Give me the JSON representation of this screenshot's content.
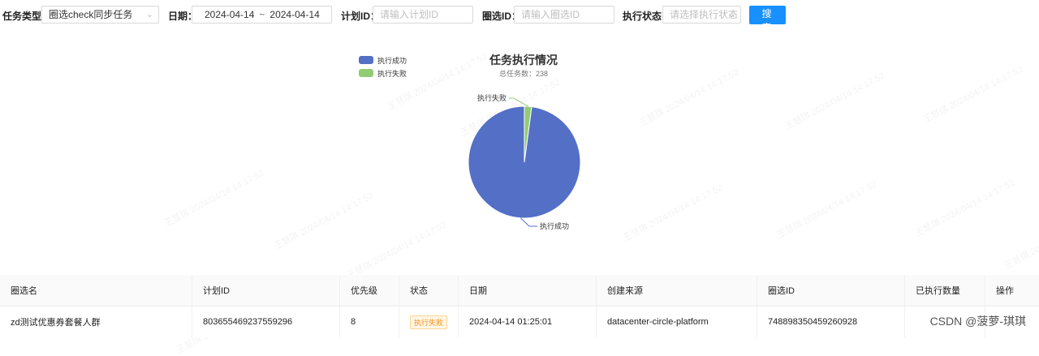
{
  "filters": {
    "task_type_label": "任务类型：",
    "task_type_value": "圈选check同步任务",
    "date_label": "日期：",
    "date_start": "2024-04-14",
    "date_sep": "~",
    "date_end": "2024-04-14",
    "plan_id_label": "计划ID：",
    "plan_id_placeholder": "请输入计划ID",
    "circle_id_label": "圈选ID：",
    "circle_id_placeholder": "请输入圈选ID",
    "status_label": "执行状态：",
    "status_placeholder": "请选择执行状态",
    "search_label": "搜 索"
  },
  "chart": {
    "title": "任务执行情况",
    "subtitle": "总任务数：238",
    "legend": [
      {
        "name": "执行成功",
        "color": "#5470c6"
      },
      {
        "name": "执行失败",
        "color": "#91cc75"
      }
    ],
    "success_label": "执行成功",
    "fail_label": "执行失败"
  },
  "chart_data": {
    "type": "pie",
    "title": "任务执行情况",
    "subtitle": "总任务数：238",
    "slices": [
      {
        "name": "执行成功",
        "value": 233,
        "color": "#5470c6"
      },
      {
        "name": "执行失败",
        "value": 5,
        "color": "#91cc75"
      }
    ],
    "legend_position": "top-left"
  },
  "watermark": "王慧琪 2024/04/14 14:17:52",
  "table": {
    "headers": [
      "圈选名",
      "计划ID",
      "优先级",
      "状态",
      "日期",
      "创建来源",
      "圈选ID",
      "已执行数量",
      "操作"
    ],
    "rows": [
      {
        "name": "zd测试优惠券套餐人群",
        "plan_id": "803655469237559296",
        "priority": "8",
        "status": "执行失败",
        "date": "2024-04-14 01:25:01",
        "source": "datacenter-circle-platform",
        "circle_id": "748898350459260928",
        "executed": "",
        "action": ""
      }
    ]
  },
  "csdn_mark": "CSDN @菠萝-琪琪"
}
